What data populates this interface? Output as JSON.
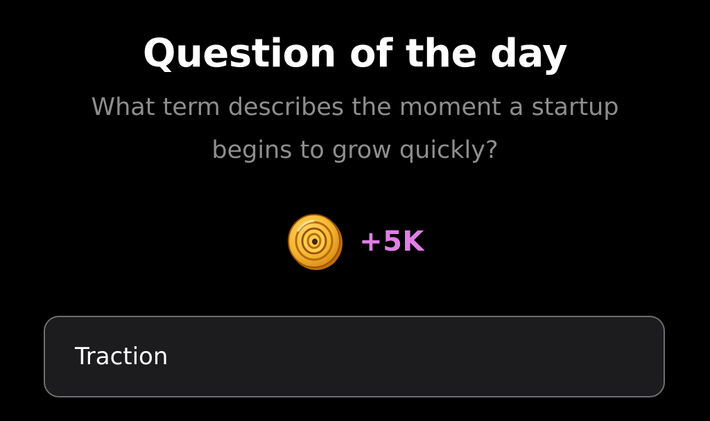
{
  "header": {
    "title": "Question of the day"
  },
  "question": {
    "text": "What term describes the moment a startup begins to grow quickly?"
  },
  "reward": {
    "icon": "coin-icon",
    "amount": "+5K"
  },
  "answer": {
    "label": "Traction"
  },
  "colors": {
    "background": "#000000",
    "title": "#ffffff",
    "question": "#8e8e8e",
    "reward": "#e07fe6",
    "coin_gold": "#f5b833",
    "answer_background": "#1c1c1e",
    "answer_border": "#6e6e6e"
  }
}
